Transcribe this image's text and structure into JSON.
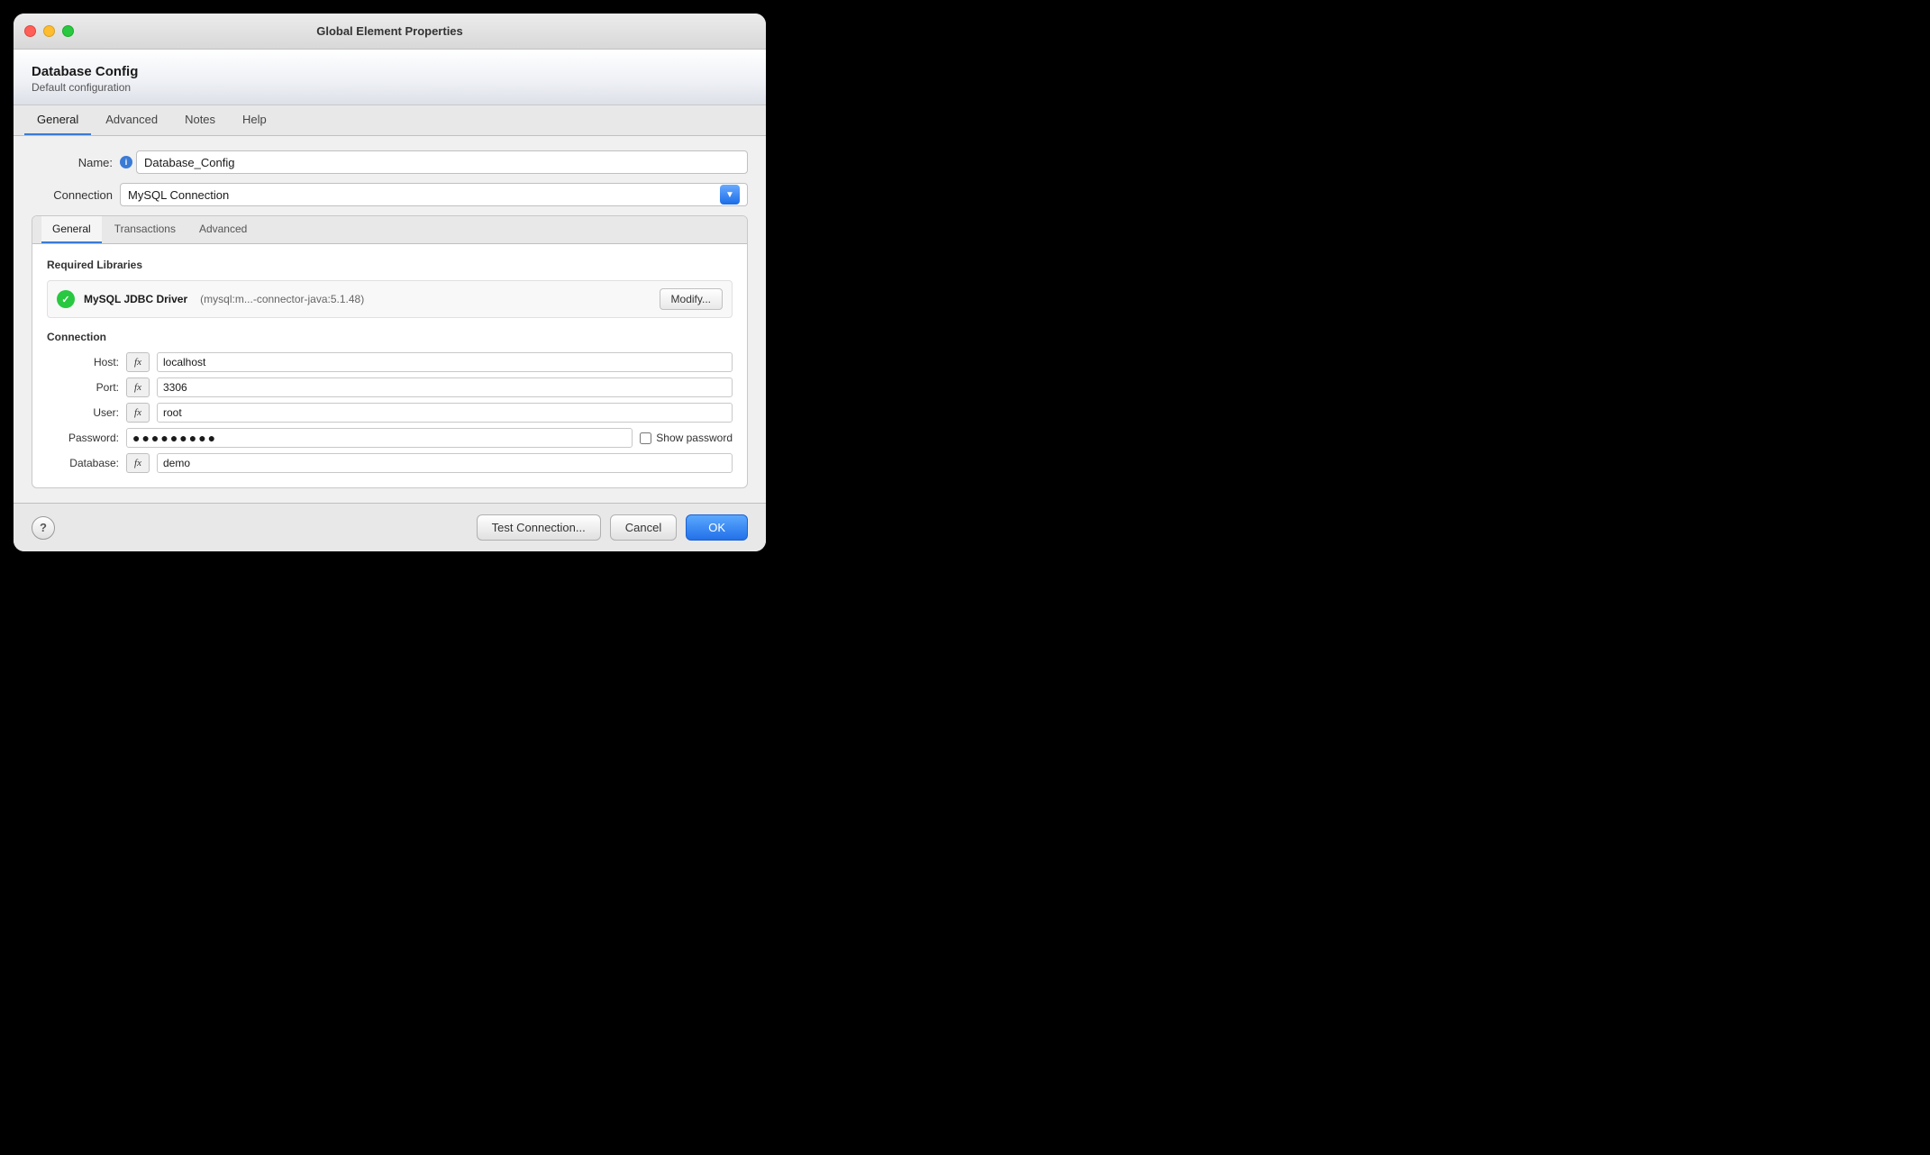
{
  "window": {
    "title": "Global Element Properties"
  },
  "header": {
    "title": "Database Config",
    "subtitle": "Default configuration"
  },
  "top_tabs": [
    {
      "label": "General",
      "active": true
    },
    {
      "label": "Advanced",
      "active": false
    },
    {
      "label": "Notes",
      "active": false
    },
    {
      "label": "Help",
      "active": false
    }
  ],
  "name_field": {
    "label": "Name:",
    "value": "Database_Config"
  },
  "connection_field": {
    "label": "Connection",
    "value": "MySQL Connection"
  },
  "inner_tabs": [
    {
      "label": "General",
      "active": true
    },
    {
      "label": "Transactions",
      "active": false
    },
    {
      "label": "Advanced",
      "active": false
    }
  ],
  "required_libraries": {
    "title": "Required Libraries",
    "driver_name": "MySQL JDBC Driver",
    "driver_version": "(mysql:m...-connector-java:5.1.48)",
    "modify_btn": "Modify..."
  },
  "connection_section": {
    "title": "Connection",
    "fields": [
      {
        "label": "Host:",
        "value": "localhost",
        "has_fx": true
      },
      {
        "label": "Port:",
        "value": "3306",
        "has_fx": true
      },
      {
        "label": "User:",
        "value": "root",
        "has_fx": true
      },
      {
        "label": "Password:",
        "value": "●●●●●●●●●",
        "has_fx": false
      },
      {
        "label": "Database:",
        "value": "demo",
        "has_fx": true
      }
    ],
    "show_password_label": "Show password"
  },
  "footer": {
    "test_btn": "Test Connection...",
    "cancel_btn": "Cancel",
    "ok_btn": "OK"
  }
}
